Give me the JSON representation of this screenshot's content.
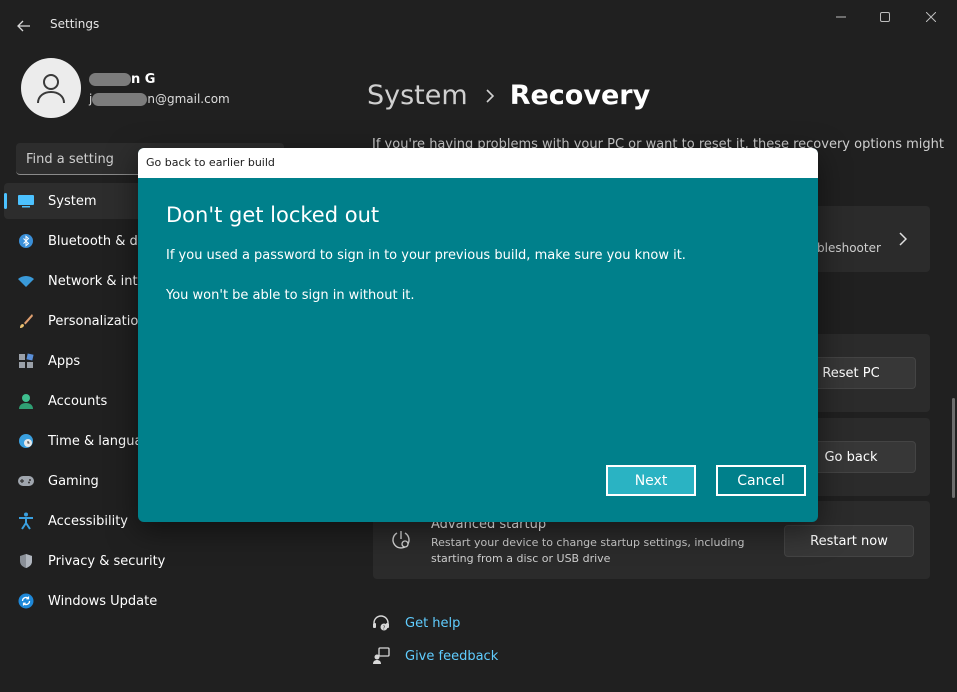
{
  "window": {
    "title": "Settings"
  },
  "user": {
    "name_suffix": "n G",
    "email_prefix": "j",
    "email_suffix": "n@gmail.com"
  },
  "search": {
    "placeholder": "Find a setting"
  },
  "sidebar": {
    "items": [
      {
        "label": "System",
        "icon": "monitor-icon",
        "active": true
      },
      {
        "label": "Bluetooth & devices",
        "icon": "bluetooth-icon"
      },
      {
        "label": "Network & internet",
        "icon": "wifi-icon"
      },
      {
        "label": "Personalization",
        "icon": "brush-icon"
      },
      {
        "label": "Apps",
        "icon": "apps-icon"
      },
      {
        "label": "Accounts",
        "icon": "person-icon"
      },
      {
        "label": "Time & language",
        "icon": "globe-clock-icon"
      },
      {
        "label": "Gaming",
        "icon": "gamepad-icon"
      },
      {
        "label": "Accessibility",
        "icon": "accessibility-icon"
      },
      {
        "label": "Privacy & security",
        "icon": "shield-icon"
      },
      {
        "label": "Windows Update",
        "icon": "update-icon"
      }
    ]
  },
  "main": {
    "breadcrumb_parent": "System",
    "breadcrumb_current": "Recovery",
    "intro": "If you're having problems with your PC or want to reset it, these recovery options might",
    "troubleshooter_tail": "bleshooter",
    "reset_button": "Reset PC",
    "goback_button": "Go back",
    "advanced_title": "Advanced startup",
    "advanced_desc": "Restart your device to change startup settings, including starting from a disc or USB drive",
    "restart_button": "Restart now",
    "help_link": "Get help",
    "feedback_link": "Give feedback"
  },
  "dialog": {
    "window_title": "Go back to earlier build",
    "heading": "Don't get locked out",
    "line1": "If you used a password to sign in to your previous build, make sure you know it.",
    "line2": "You won't be able to sign in without it.",
    "next_button": "Next",
    "cancel_button": "Cancel"
  },
  "colors": {
    "background": "#202020",
    "dialog_background": "#00808b",
    "dialog_primary_button": "#2ab3c3",
    "accent": "#4cc2ff",
    "link": "#60cdff"
  }
}
